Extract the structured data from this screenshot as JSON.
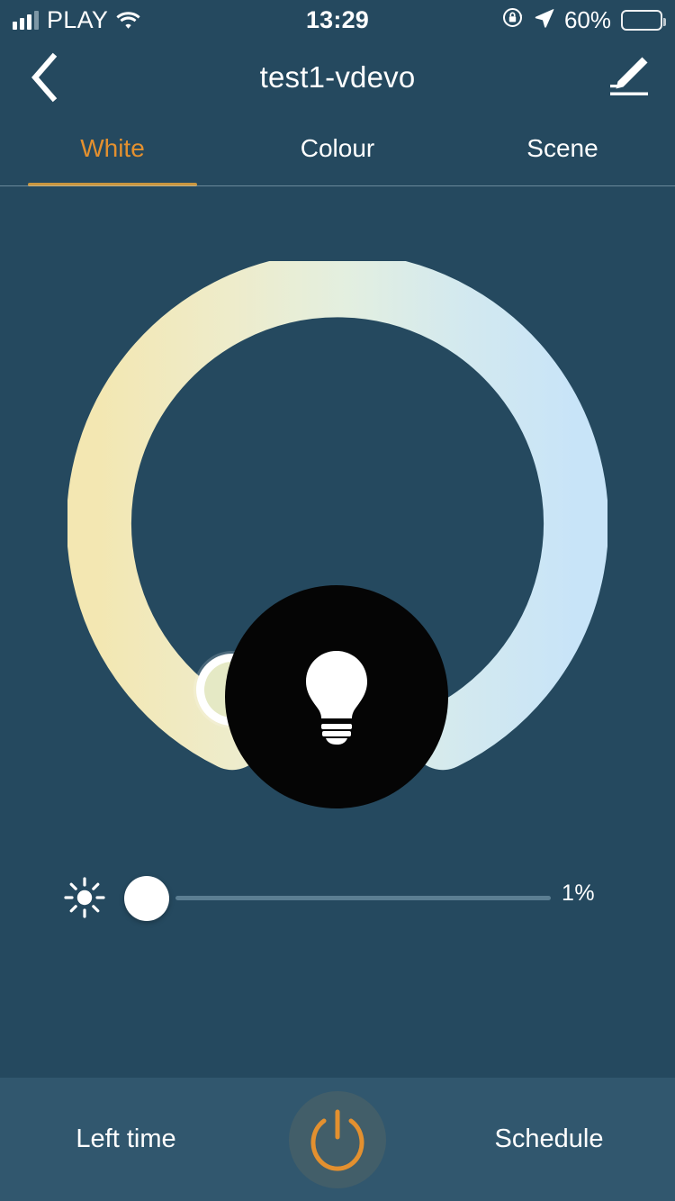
{
  "status_bar": {
    "carrier": "PLAY",
    "time": "13:29",
    "battery_percent": "60%",
    "battery_level": 60,
    "signal_bars": 3,
    "icons": {
      "signal": "signal-bars-icon",
      "wifi": "wifi-icon",
      "orientation_lock": "rotation-lock-icon",
      "location": "location-arrow-icon",
      "battery": "battery-icon"
    }
  },
  "header": {
    "title": "test1-vdevo",
    "back_icon": "chevron-left-icon",
    "edit_icon": "pencil-edit-icon"
  },
  "tabs": {
    "active_index": 0,
    "items": [
      {
        "label": "White"
      },
      {
        "label": "Colour"
      },
      {
        "label": "Scene"
      }
    ]
  },
  "color_wheel": {
    "name": "colour-temperature-ring",
    "bulb_icon": "light-bulb-icon",
    "handle_position_deg": 230,
    "gradient": {
      "warm": "#f4e9b7",
      "mid": "#e7eedc",
      "cool": "#cbe5f7"
    },
    "handle_fill": "#e4e9c4",
    "handle_ring": "#ffffff"
  },
  "brightness": {
    "icon": "brightness-sun-icon",
    "value": 1,
    "value_label": "1%",
    "min": 0,
    "max": 100,
    "track_color": "#5b7e92",
    "thumb_color": "#ffffff"
  },
  "bottom_bar": {
    "left_label": "Left time",
    "right_label": "Schedule",
    "power_icon": "power-button-icon",
    "power_color": "#e3902f",
    "background": "#31576e"
  },
  "theme": {
    "background": "#25495f",
    "accent": "#e3902f",
    "text": "#ffffff"
  }
}
